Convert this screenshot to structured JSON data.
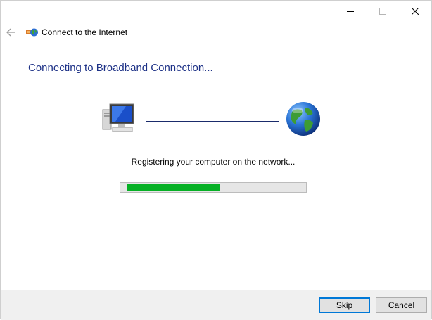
{
  "window": {
    "title": "Connect to the Internet",
    "heading": "Connecting to Broadband Connection..."
  },
  "status": {
    "message": "Registering your computer on the network...",
    "progress_fraction": 0.52
  },
  "footer": {
    "skip_label": "Skip",
    "cancel_label": "Cancel"
  },
  "colors": {
    "heading": "#1e3287",
    "progress_fill": "#06b025",
    "default_button_border": "#0078d7"
  },
  "icons": [
    "back-arrow-icon",
    "network-connection-icon",
    "computer-icon",
    "globe-icon",
    "minimize-icon",
    "maximize-icon",
    "close-icon"
  ]
}
